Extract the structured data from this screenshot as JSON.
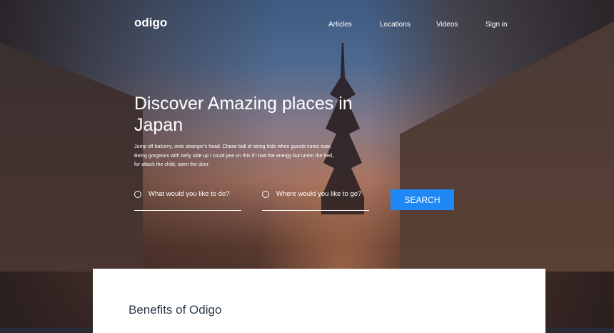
{
  "header": {
    "logo": "odigo",
    "nav": [
      "Articles",
      "Locations",
      "Videos",
      "Sign in"
    ]
  },
  "hero": {
    "title": "Discover Amazing places in Japan",
    "description": "Jump off balcony, onto stranger's head. Chase ball of string hide when guests come over. Being gorgeous with belly side up i could pee on this if i had the energy but under the bed, for attack the child, open the door.",
    "what_placeholder": "What would you like to do?",
    "where_placeholder": "Where would you like to go?",
    "search_label": "SEARCH"
  },
  "section": {
    "title": "Benefits of Odigo"
  },
  "colors": {
    "accent": "#1e88f5"
  }
}
